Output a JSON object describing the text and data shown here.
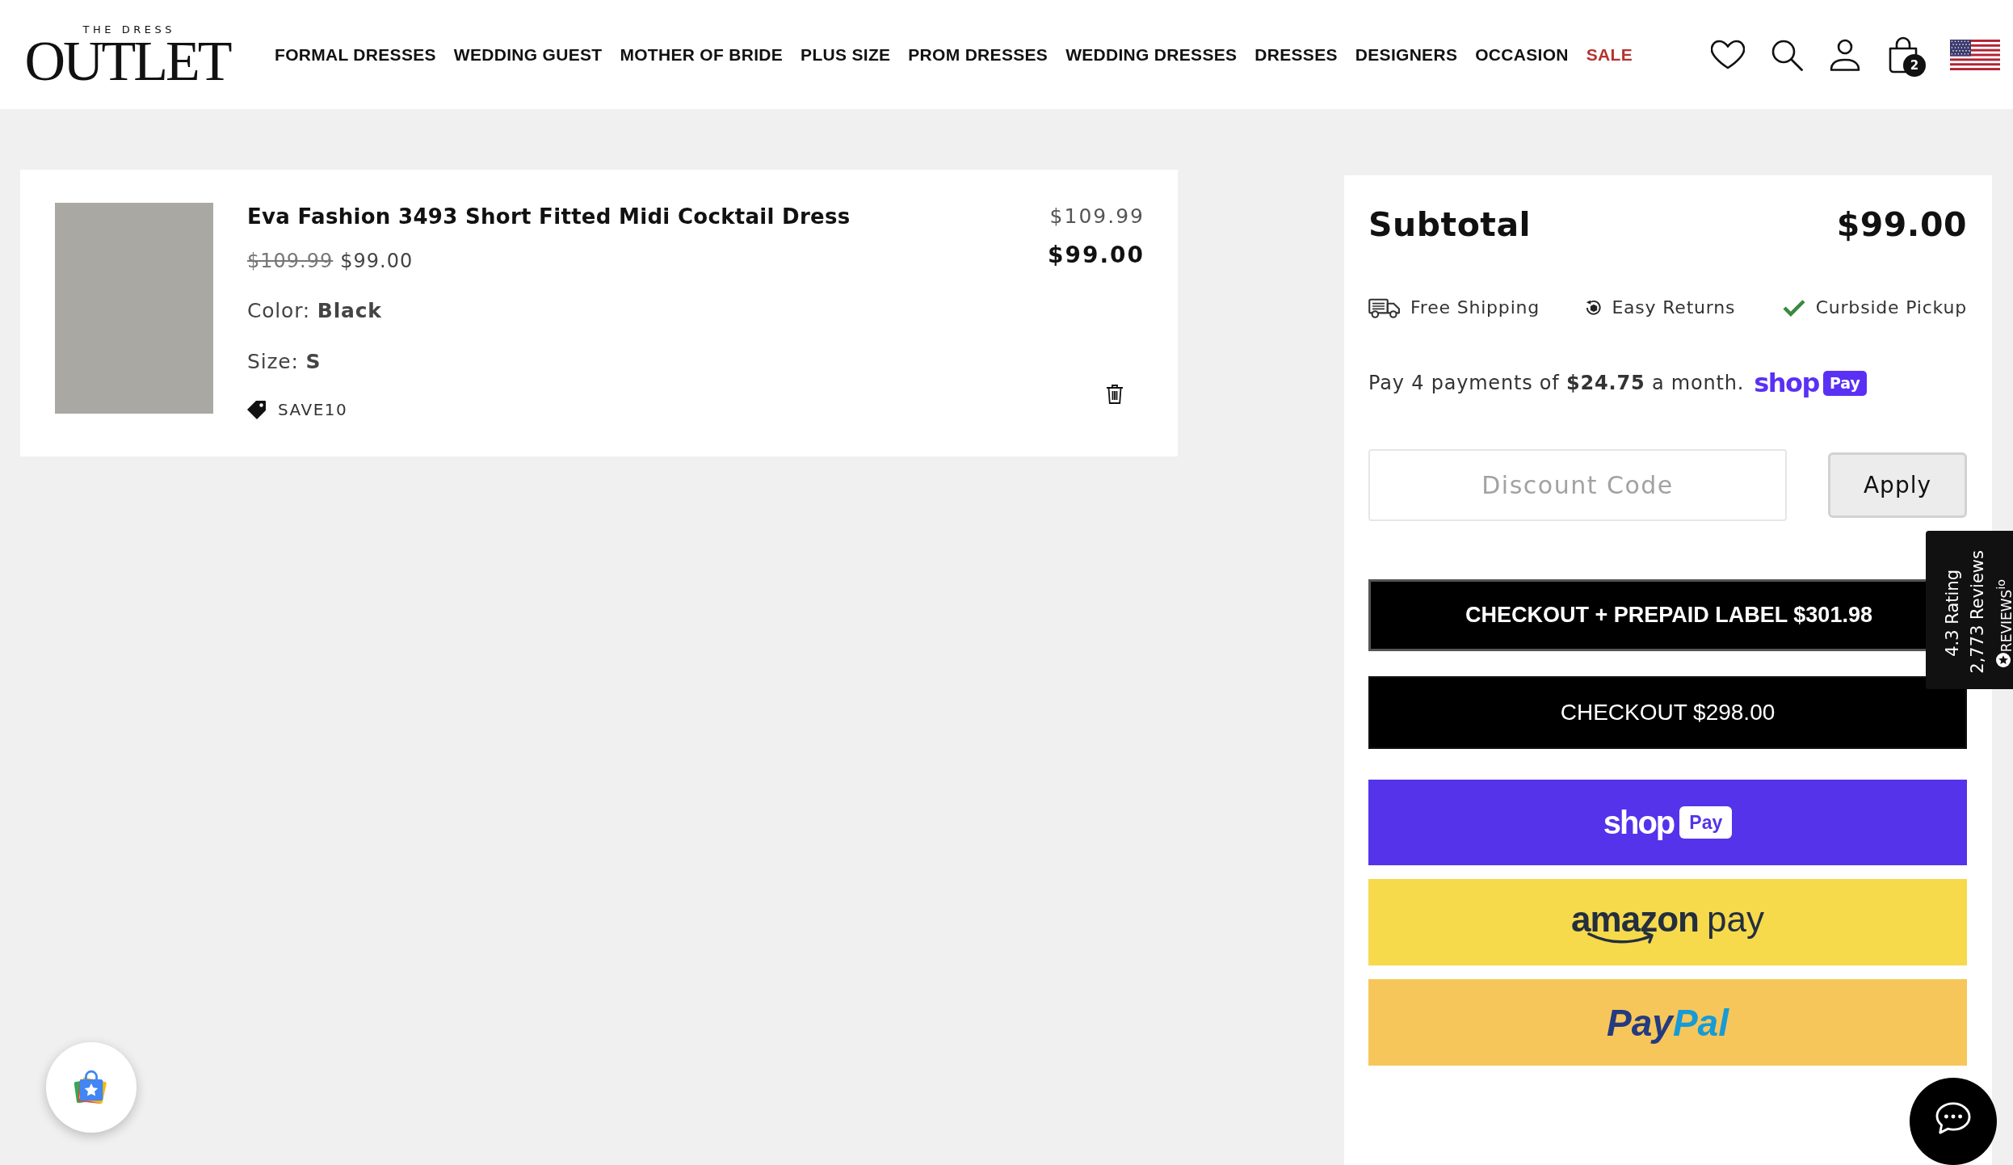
{
  "header": {
    "logo": {
      "tagline": "THE DRESS",
      "name": "OUTLET"
    },
    "nav": [
      {
        "label": "FORMAL DRESSES",
        "kind": "link"
      },
      {
        "label": "WEDDING GUEST",
        "kind": "link"
      },
      {
        "label": "MOTHER OF BRIDE",
        "kind": "link"
      },
      {
        "label": "PLUS SIZE",
        "kind": "link"
      },
      {
        "label": "PROM DRESSES",
        "kind": "link"
      },
      {
        "label": "WEDDING DRESSES",
        "kind": "link"
      },
      {
        "label": "DRESSES",
        "kind": "link"
      },
      {
        "label": "DESIGNERS",
        "kind": "link"
      },
      {
        "label": "OCCASION",
        "kind": "link"
      },
      {
        "label": "SALE",
        "kind": "sale"
      }
    ],
    "cart_count": "2"
  },
  "cart": {
    "items": [
      {
        "title": "Eva Fashion 3493 Short Fitted Midi Cocktail Dress",
        "compare_price": "$109.99",
        "price": "$99.00",
        "color_option": "Color: **Black**",
        "size_option": "Size: **S**",
        "discount_code": "SAVE10",
        "line_compare_price": "$109.99",
        "line_total": "$99.00"
      }
    ]
  },
  "summary": {
    "subtotal_label": "Subtotal",
    "subtotal": "$99.00",
    "perks": [
      {
        "kind": "shipping",
        "label": "Free Shipping"
      },
      {
        "kind": "returns",
        "label": "Easy Returns"
      },
      {
        "kind": "pickup",
        "label": "Curbside Pickup"
      }
    ],
    "installments": {
      "text": "Pay 4 payments of **$24.75** a month.",
      "logo": [
        "shop",
        "Pay"
      ]
    },
    "discount": {
      "placeholder": "Discount Code",
      "button": "Apply"
    },
    "checkout_buttons": [
      {
        "kind": "bold",
        "label": "CHECKOUT + PREPAID LABEL $301.98"
      },
      {
        "kind": "regular",
        "label": "CHECKOUT $298.00"
      }
    ],
    "express_buttons": [
      {
        "kind": "shop_pay",
        "parts": [
          "shop",
          "Pay"
        ]
      },
      {
        "kind": "amazon_pay",
        "parts": [
          "amazon",
          "pay"
        ]
      },
      {
        "kind": "paypal",
        "parts": [
          "Pay",
          "Pal"
        ]
      }
    ]
  },
  "reviews_tab": {
    "rating": "4.3 Rating",
    "count": "2,773 Reviews",
    "brand": "REVIEWS$^{io}$"
  }
}
